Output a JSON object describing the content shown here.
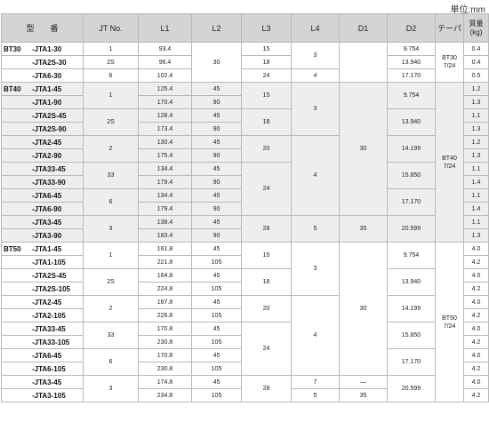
{
  "unit_label": "単位:mm",
  "headers": {
    "model": "型　　番",
    "jt": "JT No.",
    "l1": "L1",
    "l2": "L2",
    "l3": "L3",
    "l4": "L4",
    "d1": "D1",
    "d2": "D2",
    "taper": "テーパ",
    "mass_line1": "質量",
    "mass_line2": "(kg)"
  },
  "rows": [
    {
      "prefix": "BT30",
      "suffix": "-JTA1-30",
      "l1": "93.4",
      "mass": "0.4"
    },
    {
      "prefix": "",
      "suffix": "-JTA2S-30",
      "l1": "96.4",
      "mass": "0.4"
    },
    {
      "prefix": "",
      "suffix": "-JTA6-30",
      "l1": "102.4",
      "mass": "0.5"
    },
    {
      "prefix": "BT40",
      "suffix": "-JTA1-45",
      "l1": "125.4",
      "l2": "45",
      "mass": "1.2"
    },
    {
      "prefix": "",
      "suffix": "-JTA1-90",
      "l1": "170.4",
      "l2": "90",
      "mass": "1.3"
    },
    {
      "prefix": "",
      "suffix": "-JTA2S-45",
      "l1": "128.4",
      "l2": "45",
      "mass": "1.1"
    },
    {
      "prefix": "",
      "suffix": "-JTA2S-90",
      "l1": "173.4",
      "l2": "90",
      "mass": "1.3"
    },
    {
      "prefix": "",
      "suffix": "-JTA2-45",
      "l1": "130.4",
      "l2": "45",
      "mass": "1.2"
    },
    {
      "prefix": "",
      "suffix": "-JTA2-90",
      "l1": "175.4",
      "l2": "90",
      "mass": "1.3"
    },
    {
      "prefix": "",
      "suffix": "-JTA33-45",
      "l1": "134.4",
      "l2": "45",
      "mass": "1.1"
    },
    {
      "prefix": "",
      "suffix": "-JTA33-90",
      "l1": "179.4",
      "l2": "90",
      "mass": "1.4"
    },
    {
      "prefix": "",
      "suffix": "-JTA6-45",
      "l1": "134.4",
      "l2": "45",
      "mass": "1.1"
    },
    {
      "prefix": "",
      "suffix": "-JTA6-90",
      "l1": "179.4",
      "l2": "90",
      "mass": "1.4"
    },
    {
      "prefix": "",
      "suffix": "-JTA3-45",
      "l1": "138.4",
      "l2": "45",
      "mass": "1.1"
    },
    {
      "prefix": "",
      "suffix": "-JTA3-90",
      "l1": "183.4",
      "l2": "90",
      "mass": "1.3"
    },
    {
      "prefix": "BT50",
      "suffix": "-JTA1-45",
      "l1": "161.8",
      "l2": "45",
      "mass": "4.0"
    },
    {
      "prefix": "",
      "suffix": "-JTA1-105",
      "l1": "221.8",
      "l2": "105",
      "mass": "4.2"
    },
    {
      "prefix": "",
      "suffix": "-JTA2S-45",
      "l1": "164.8",
      "l2": "45",
      "mass": "4.0"
    },
    {
      "prefix": "",
      "suffix": "-JTA2S-105",
      "l1": "224.8",
      "l2": "105",
      "mass": "4.2"
    },
    {
      "prefix": "",
      "suffix": "-JTA2-45",
      "l1": "167.8",
      "l2": "45",
      "mass": "4.0"
    },
    {
      "prefix": "",
      "suffix": "-JTA2-105",
      "l1": "226.8",
      "l2": "105",
      "mass": "4.2"
    },
    {
      "prefix": "",
      "suffix": "-JTA33-45",
      "l1": "170.8",
      "l2": "45",
      "mass": "4.0"
    },
    {
      "prefix": "",
      "suffix": "-JTA33-105",
      "l1": "230.8",
      "l2": "105",
      "mass": "4.2"
    },
    {
      "prefix": "",
      "suffix": "-JTA6-45",
      "l1": "170.8",
      "l2": "45",
      "mass": "4.0"
    },
    {
      "prefix": "",
      "suffix": "-JTA6-105",
      "l1": "230.8",
      "l2": "105",
      "mass": "4.2"
    },
    {
      "prefix": "",
      "suffix": "-JTA3-45",
      "l1": "174.8",
      "l2": "45",
      "mass": "4.0"
    },
    {
      "prefix": "",
      "suffix": "-JTA3-105",
      "l1": "234.8",
      "l2": "105",
      "mass": "4.2"
    }
  ],
  "merged": {
    "jt": [
      "1",
      "2S",
      "6",
      "1",
      "2S",
      "2",
      "33",
      "6",
      "3",
      "1",
      "2S",
      "2",
      "33",
      "6",
      "3"
    ],
    "l2_bt30": "30",
    "l3_bt30": [
      "15",
      "18",
      "24"
    ],
    "l3_bt40": [
      "15",
      "18",
      "20",
      "24",
      "28"
    ],
    "l3_bt50": [
      "15",
      "18",
      "20",
      "24",
      "28"
    ],
    "l4": [
      "3",
      "4",
      "3",
      "4",
      "5",
      "3",
      "4",
      "7",
      "5"
    ],
    "d1": [
      "30",
      "35",
      "30",
      "—",
      "35"
    ],
    "d2": [
      "9.754",
      "13.940",
      "17.170",
      "9.754",
      "13.940",
      "14.199",
      "15.850",
      "17.170",
      "20.599",
      "9.754",
      "13.940",
      "14.199",
      "15.850",
      "17.170",
      "20.599"
    ],
    "taper": [
      {
        "line1": "BT30",
        "line2": "7/24"
      },
      {
        "line1": "BT40",
        "line2": "7/24"
      },
      {
        "line1": "BT50",
        "line2": "7/24"
      }
    ]
  }
}
